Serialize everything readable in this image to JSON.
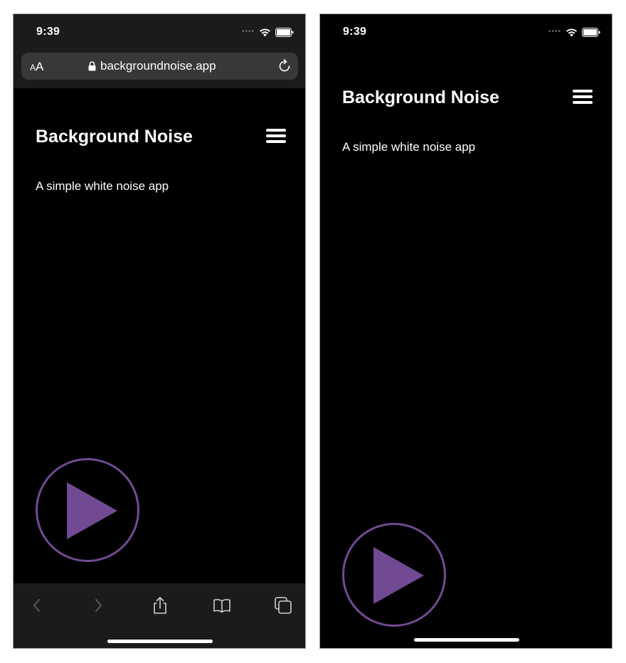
{
  "browser_screen": {
    "status": {
      "time": "9:39"
    },
    "address_bar": {
      "text_size_label_small": "A",
      "text_size_label_large": "A",
      "url": "backgroundnoise.app"
    },
    "app": {
      "title": "Background Noise",
      "subtitle": "A simple white noise app"
    },
    "toolbar": {
      "items": [
        "back-icon",
        "forward-icon",
        "share-icon",
        "bookmarks-icon",
        "tabs-icon"
      ]
    }
  },
  "standalone_screen": {
    "status": {
      "time": "9:39"
    },
    "app": {
      "title": "Background Noise",
      "subtitle": "A simple white noise app"
    }
  },
  "colors": {
    "background": "#000000",
    "chrome": "#1b1b1b",
    "address_bar": "#383838",
    "accent_purple": "#714a93",
    "text": "#ffffff",
    "toolbar_disabled": "#5a5a5a"
  },
  "icons": [
    "wifi-icon",
    "battery-icon",
    "lock-icon",
    "reload-icon",
    "hamburger-menu-icon",
    "play-icon"
  ]
}
